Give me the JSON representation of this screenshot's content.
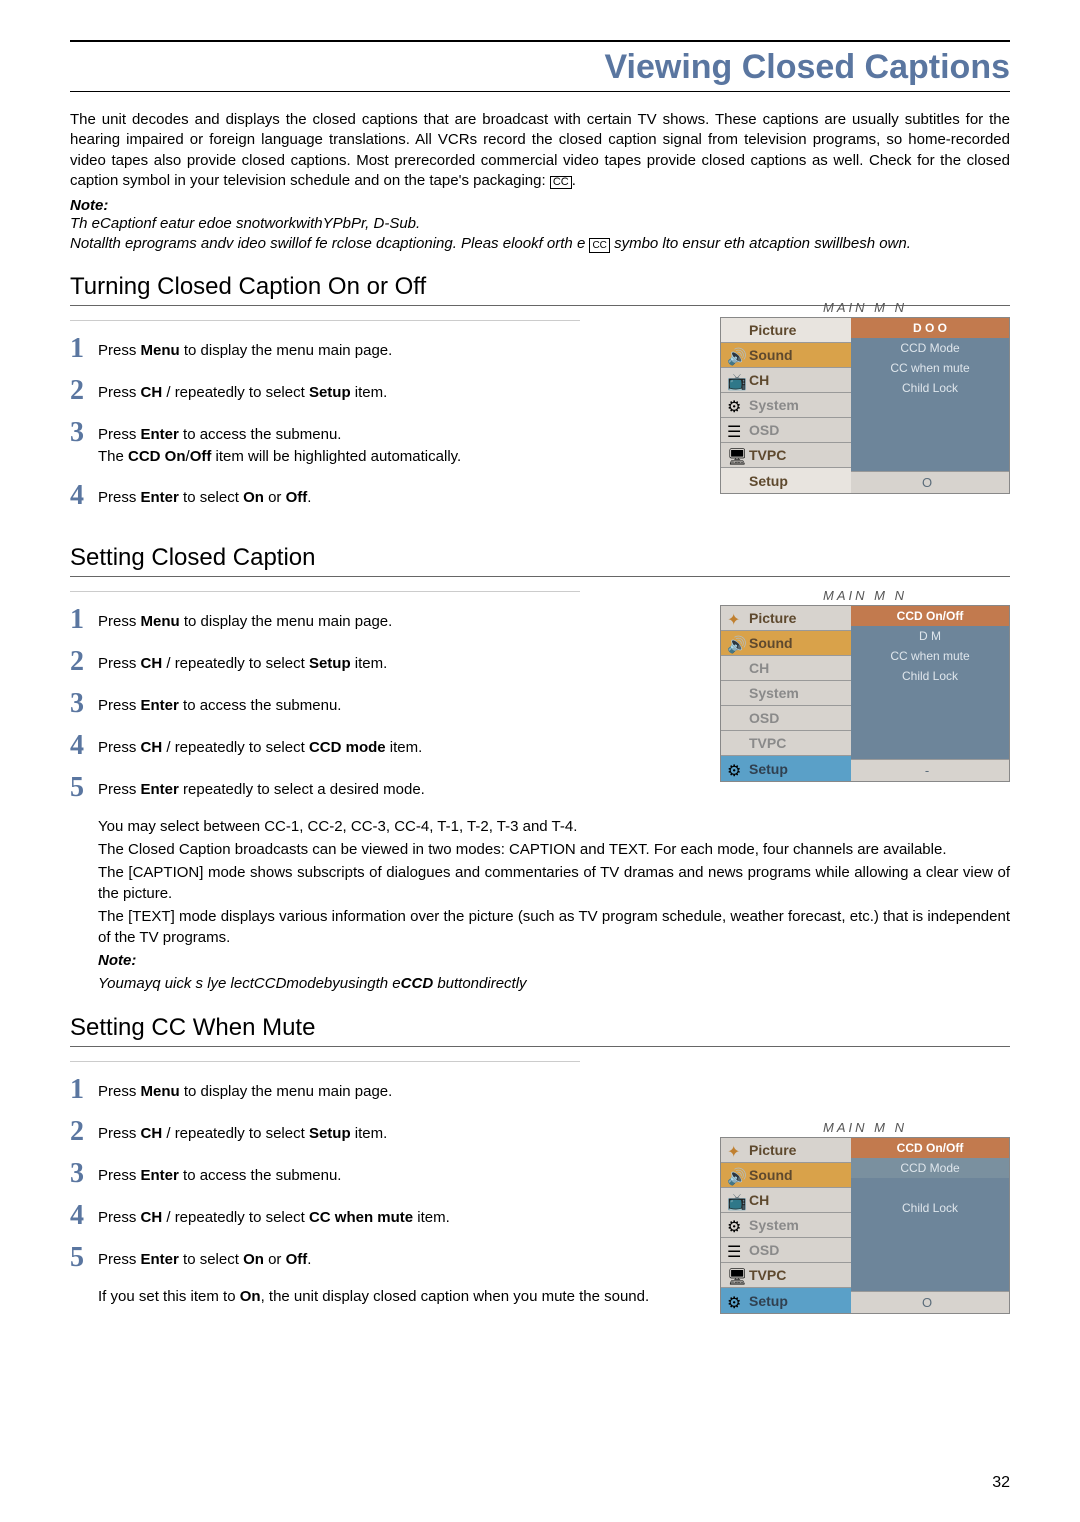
{
  "page_title": "Viewing Closed Captions",
  "intro": "The unit decodes and displays the closed captions that are broadcast with certain TV shows. These captions are usually subtitles for the hearing impaired or foreign language translations. All VCRs record the closed caption signal from television programs, so home-recorded video tapes also provide closed captions. Most prerecorded commercial video tapes provide closed captions as well. Check for the closed caption symbol in your television schedule and on the tape's packaging: ",
  "cc_box": "CC",
  "note_label": "Note:",
  "note_line1": "Th eCaptionf eatur edoe snotworkwithYPbPr, D-Sub.",
  "note_line2_a": "Notallth eprograms andv ideo swillof fe rclose dcaptioning. Pleas elookf orth e",
  "note_line2_b": "symbo lto ensur eth atcaption swillbesh own.",
  "cc_small": "CC",
  "sec1_title": "Turning Closed Caption On or Off",
  "sec1_steps": {
    "s1": "Press  Menu to display the menu main page.",
    "s2": "Press  CH    /     repeatedly to select Setup item.",
    "s3a": "Press Enter to access the submenu.",
    "s3b": "The CCD On/Off  item will be highlighted automatically.",
    "s4": "Press Enter to select On or Off."
  },
  "sec2_title": "Setting Closed Caption",
  "sec2_steps": {
    "s1": "Press  Menu to display the menu main page.",
    "s2": "Press  CH    /     repeatedly to select Setup item.",
    "s3": "Press Enter to access the submenu.",
    "s4": "Press  CH    /     repeatedly to select CCD mode item.",
    "s5": "Press Enter repeatedly to select a desired mode."
  },
  "sec2_cont": {
    "l1": "You may select between CC-1, CC-2, CC-3, CC-4, T-1, T-2, T-3 and  T-4.",
    "l2": "The Closed Caption broadcasts can be viewed in two modes: CAPTION and TEXT. For each mode, four channels are available.",
    "l3": "The [CAPTION] mode shows subscripts of dialogues and commentaries of TV dramas and news programs while allowing a clear view of the picture.",
    "l4": "The [TEXT] mode displays various information over the picture (such as TV program schedule, weather forecast, etc.) that is independent of the TV programs.",
    "note_label": "Note:",
    "note": "Youmayq uick s lye lectCCDmodebyusingth eCCD buttondirectly"
  },
  "sec3_title": "Setting CC When Mute",
  "sec3_steps": {
    "s1": "Press  Menu to display the menu main page.",
    "s2": "Press  CH    /     repeatedly to select Setup item.",
    "s3": "Press Enter to access the submenu.",
    "s4": "Press  CH    /     repeatedly to select CC when mute item.",
    "s5": "Press Enter to select On or Off."
  },
  "sec3_cont": "If you set this item to On, the unit display closed caption when you mute the sound.",
  "menu_common": {
    "title": "MAIN M    N",
    "items": [
      "Picture",
      "Sound",
      "CH",
      "System",
      "OSD",
      "TVPC",
      "Setup"
    ],
    "footer_hint": "O"
  },
  "menu1_right": [
    "D O       O",
    "CCD Mode",
    "CC when mute",
    "Child Lock"
  ],
  "menu2_right": [
    "CCD On/Off",
    "D M",
    "CC when mute",
    "Child Lock"
  ],
  "menu2_right_extra": "-",
  "menu3_right": [
    "CCD On/Off",
    "CCD Mode",
    "",
    "Child Lock"
  ],
  "page_number": "32"
}
